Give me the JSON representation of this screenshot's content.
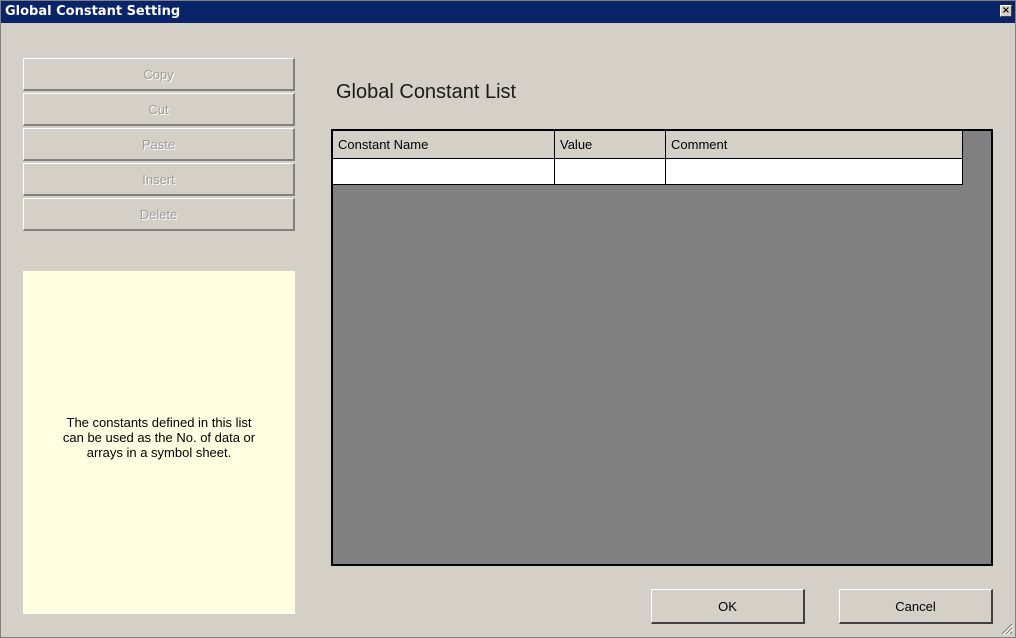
{
  "window": {
    "title": "Global Constant Setting",
    "close_glyph": "×"
  },
  "sidebar": {
    "buttons": [
      {
        "label": "Copy",
        "enabled": false
      },
      {
        "label": "Cut",
        "enabled": false
      },
      {
        "label": "Paste",
        "enabled": false
      },
      {
        "label": "Insert",
        "enabled": false
      },
      {
        "label": "Delete",
        "enabled": false
      }
    ],
    "info_lines": [
      "The constants defined in this list",
      "can be used as the No. of data or",
      "arrays in a symbol sheet."
    ]
  },
  "main": {
    "list_title": "Global Constant List",
    "columns": [
      "Constant Name",
      "Value",
      "Comment"
    ],
    "rows": [
      [
        "",
        "",
        ""
      ]
    ]
  },
  "footer": {
    "ok_label": "OK",
    "cancel_label": "Cancel"
  },
  "colors": {
    "titlebar": "#0a246a",
    "info_background": "#ffffe1",
    "grid_background": "#808080",
    "dialog_face": "#d4d0c8"
  }
}
